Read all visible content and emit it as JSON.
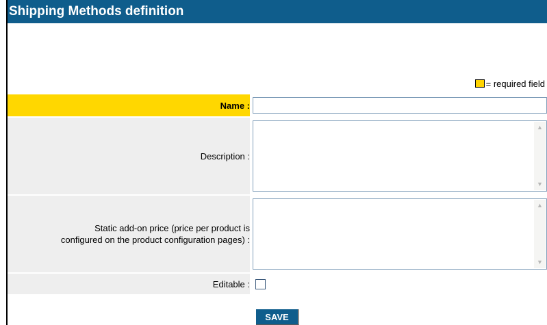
{
  "header": {
    "title": "Shipping Methods definition"
  },
  "legend": {
    "text": "= required field",
    "swatch_color": "#ffd400"
  },
  "form": {
    "name": {
      "label": "Name :",
      "value": ""
    },
    "description": {
      "label": "Description :",
      "value": ""
    },
    "static_price": {
      "label_line1": "Static add-on price (price per product is",
      "label_line2": "configured on the product configuration pages) :",
      "value": ""
    },
    "editable": {
      "label": "Editable :",
      "checked": false
    }
  },
  "buttons": {
    "save_label": "SAVE"
  },
  "colors": {
    "header": "#0f5d8c",
    "required": "#ffd700",
    "row_bg": "#eeeeee"
  }
}
